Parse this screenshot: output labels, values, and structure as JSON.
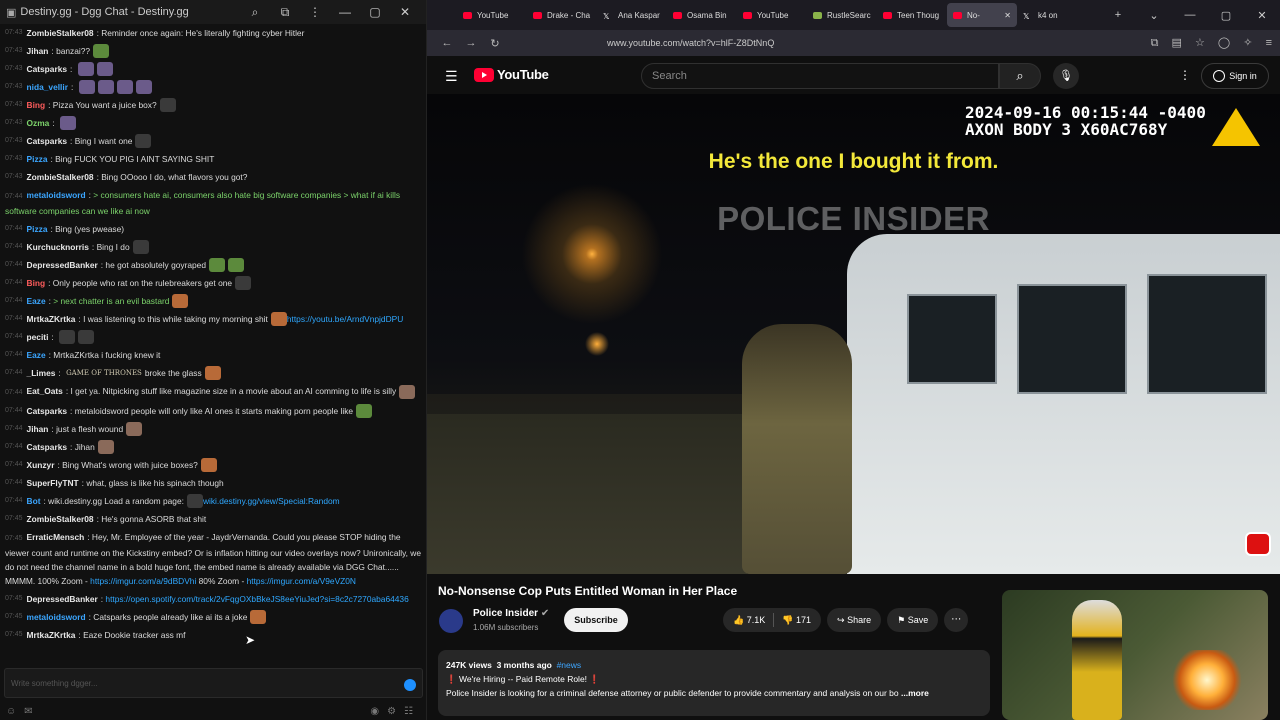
{
  "chat_window": {
    "title": "Destiny.gg - Dgg Chat - Destiny.gg",
    "input_placeholder": "Write something dgger...",
    "messages": [
      {
        "ts": "07:43",
        "user": "ZombieStalker08",
        "user_color": "white",
        "text": "Reminder once again: He's literally fighting cyber Hitler"
      },
      {
        "ts": "07:43",
        "user": "Jihan",
        "user_color": "white",
        "text": "banzai??"
      },
      {
        "ts": "07:43",
        "user": "Catsparks",
        "user_color": "white",
        "text": ""
      },
      {
        "ts": "07:43",
        "user": "nida_vellir",
        "user_color": "blue",
        "text": ""
      },
      {
        "ts": "07:43",
        "user": "Bing",
        "user_color": "red",
        "text": "Pizza You want a juice box?"
      },
      {
        "ts": "07:43",
        "user": "Ozma",
        "user_color": "green",
        "text": ""
      },
      {
        "ts": "07:43",
        "user": "Catsparks",
        "user_color": "white",
        "text": "Bing I want one"
      },
      {
        "ts": "07:43",
        "user": "Pizza",
        "user_color": "blue",
        "text": "Bing FUCK YOU PIG I AINT SAYING SHIT"
      },
      {
        "ts": "07:43",
        "user": "ZombieStalker08",
        "user_color": "white",
        "text": "Bing OOooo I do, what flavors you got?"
      },
      {
        "ts": "07:44",
        "user": "metaloidsword",
        "user_color": "blue",
        "text": "> consumers hate ai, consumers also hate big software companies > what if ai kills software companies can we like ai now"
      },
      {
        "ts": "07:44",
        "user": "Pizza",
        "user_color": "blue",
        "text": "Bing (yes pwease)"
      },
      {
        "ts": "07:44",
        "user": "Kurchucknorris",
        "user_color": "white",
        "text": "Bing I do"
      },
      {
        "ts": "07:44",
        "user": "DepressedBanker",
        "user_color": "white",
        "text": "he got absolutely goyraped"
      },
      {
        "ts": "07:44",
        "user": "Bing",
        "user_color": "red",
        "text": "Only people who rat on the rulebreakers get one"
      },
      {
        "ts": "07:44",
        "user": "Eaze",
        "user_color": "blue",
        "text": "> next chatter is an evil bastard"
      },
      {
        "ts": "07:44",
        "user": "MrtkaZKrtka",
        "user_color": "white",
        "text": "I was listening to this while taking my morning shit",
        "link": "https://youtu.be/ArndVnpjdDPU"
      },
      {
        "ts": "07:44",
        "user": "peciti",
        "user_color": "white",
        "text": ""
      },
      {
        "ts": "07:44",
        "user": "Eaze",
        "user_color": "blue",
        "text": "MrtkaZKrtka i fucking knew it"
      },
      {
        "ts": "07:44",
        "user": "_Limes",
        "user_color": "white",
        "text": "broke the glass"
      },
      {
        "ts": "07:44",
        "user": "Eat_Oats",
        "user_color": "white",
        "text": "I get ya. Nitpicking stuff like magazine size in a movie about an AI comming to life is silly"
      },
      {
        "ts": "07:44",
        "user": "Catsparks",
        "user_color": "white",
        "text": "metaloidsword people will only like AI ones it starts making porn people like"
      },
      {
        "ts": "07:44",
        "user": "Jihan",
        "user_color": "white",
        "text": "just a flesh wound"
      },
      {
        "ts": "07:44",
        "user": "Catsparks",
        "user_color": "white",
        "text": "Jihan"
      },
      {
        "ts": "07:44",
        "user": "Xunzyr",
        "user_color": "white",
        "text": "Bing What's wrong with juice boxes?"
      },
      {
        "ts": "07:44",
        "user": "SuperFlyTNT",
        "user_color": "white",
        "text": "what, glass is like his spinach though"
      },
      {
        "ts": "07:44",
        "user": "Bot",
        "user_color": "blue",
        "text": "wiki.destiny.gg Load a random page:",
        "link": "wiki.destiny.gg/view/Special:Random"
      },
      {
        "ts": "07:45",
        "user": "ZombieStalker08",
        "user_color": "white",
        "text": "He's gonna ASORB that shit"
      },
      {
        "ts": "07:45",
        "user": "ErraticMensch",
        "user_color": "white",
        "text": "Hey, Mr. Employee of the year - JaydrVernanda. Could you please STOP hiding the viewer count and runtime on the Kickstiny embed? Or is inflation hitting our video overlays now? Unironically, we do not need the channel name in a bold huge font, the embed name is already available via DGG Chat...... MMMM. 100% Zoom -",
        "link": "https://imgur.com/a/9dBDVhi",
        "text2": "80% Zoom -",
        "link2": "https://imgur.com/a/V9eVZ0N"
      },
      {
        "ts": "07:45",
        "user": "DepressedBanker",
        "user_color": "white",
        "text": "",
        "link": "https://open.spotify.com/track/2vFqgOXbBkeJS8eeYiuJed?si=8c2c7270aba64436"
      },
      {
        "ts": "07:45",
        "user": "metaloidsword",
        "user_color": "blue",
        "text": "Catsparks people already like ai its a joke"
      },
      {
        "ts": "07:45",
        "user": "MrtkaZKrtka",
        "user_color": "white",
        "text": "Eaze Dookie tracker ass mf"
      }
    ],
    "got_emote_text": "GAME OF THRONES"
  },
  "browser": {
    "tabs": [
      {
        "label": "YouTube",
        "icon": "youtube-icon"
      },
      {
        "label": "Drake - Cha",
        "icon": "youtube-icon"
      },
      {
        "label": "Ana Kaspar",
        "icon": "x-icon"
      },
      {
        "label": "Osama Bin",
        "icon": "youtube-icon"
      },
      {
        "label": "YouTube",
        "icon": "youtube-icon"
      },
      {
        "label": "RustleSearc",
        "icon": "rustle-icon"
      },
      {
        "label": "Teen Thoug",
        "icon": "youtube-icon"
      },
      {
        "label": "No-",
        "icon": "youtube-icon",
        "active": true
      },
      {
        "label": "k4 on",
        "icon": "x-icon"
      }
    ],
    "url": "www.youtube.com/watch?v=hlF-Z8DtNnQ"
  },
  "youtube": {
    "logo_text": "YouTube",
    "search_placeholder": "Search",
    "signin_label": "Sign in",
    "video": {
      "timestamp_line1": "2024-09-16 00:15:44 -0400",
      "timestamp_line2": "AXON BODY 3 X60AC768Y",
      "caption": "He's the one I bought it from.",
      "watermark": "POLICE INSIDER"
    },
    "title": "No-Nonsense Cop Puts Entitled Woman in Her Place",
    "channel": {
      "name": "Police Insider",
      "subscribers": "1.06M subscribers"
    },
    "subscribe_label": "Subscribe",
    "likes": "7.1K",
    "dislikes": "171",
    "share_label": "Share",
    "save_label": "Save",
    "description": {
      "views": "247K views",
      "age": "3 months ago",
      "hashtag": "#news",
      "line1": "We're Hiring -- Paid Remote Role!",
      "line2": "Police Insider is looking for a criminal defense attorney or public defender to provide commentary and analysis on our bo",
      "more": "...more"
    }
  }
}
